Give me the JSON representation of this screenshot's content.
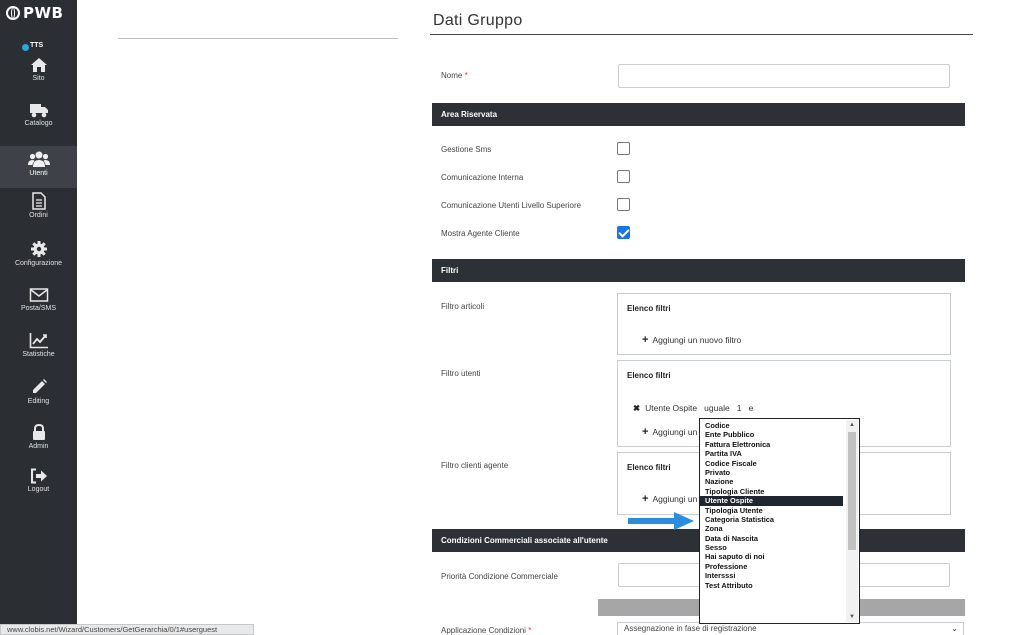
{
  "brand": {
    "name": "PWB",
    "env_label": "TTS"
  },
  "nav": [
    {
      "label": "Sito",
      "icon": "home-icon"
    },
    {
      "label": "Catalogo",
      "icon": "truck-icon"
    },
    {
      "label": "Utenti",
      "icon": "users-icon",
      "active": true
    },
    {
      "label": "Ordini",
      "icon": "document-icon"
    },
    {
      "label": "Configurazione",
      "icon": "gear-icon"
    },
    {
      "label": "Posta/SMS",
      "icon": "envelope-icon"
    },
    {
      "label": "Statistiche",
      "icon": "chart-icon"
    },
    {
      "label": "Editing",
      "icon": "pencil-icon"
    },
    {
      "label": "Admin",
      "icon": "lock-icon"
    },
    {
      "label": "Logout",
      "icon": "logout-icon"
    }
  ],
  "status_bar": {
    "url": "www.clobis.net/Wizard/Customers/GetGerarchia/0/1#userguest"
  },
  "form": {
    "title": "Dati Gruppo",
    "nome_label": "Nome",
    "nome_value": "",
    "required_mark": "*",
    "section_area_riservata": "Area Riservata",
    "checkboxes": [
      {
        "label": "Gestione Sms",
        "checked": false
      },
      {
        "label": "Comunicazione Interna",
        "checked": false
      },
      {
        "label": "Comunicazione Utenti Livello Superiore",
        "checked": false
      },
      {
        "label": "Mostra Agente Cliente",
        "checked": true
      }
    ],
    "section_filtri": "Filtri",
    "filters": [
      {
        "label": "Filtro articoli",
        "box_title": "Elenco filtri",
        "add_label": "Aggiungi un nuovo filtro"
      },
      {
        "label": "Filtro utenti",
        "box_title": "Elenco filtri",
        "row": "Utente Ospite   uguale   1   e",
        "add_label": "Aggiungi un"
      },
      {
        "label": "Filtro clienti agente",
        "box_title": "Elenco filtri",
        "add_label": "Aggiungi un"
      }
    ],
    "section_condizioni": "Condizioni Commerciali associate all'utente",
    "priorita_label": "Priorità Condizione Commerciale",
    "applicazione_label": "Applicazione Condizioni",
    "applicazione_value": "Assegnazione in fase di registrazione"
  },
  "dropdown": {
    "selected_index": 8,
    "options": [
      "Codice",
      "Ente Pubblico",
      "Fattura Elettronica",
      "Partita IVA",
      "Codice Fiscale",
      "Privato",
      "Nazione",
      "Tipologia Cliente",
      "Utente Ospite",
      "Tipologia Utente",
      "Categoria Statistica",
      "Zona",
      "Data di Nascita",
      "Sesso",
      "Hai saputo di noi",
      "Professione",
      "Intersssi",
      "Test Attributo"
    ]
  },
  "colors": {
    "sidebar": "#2b2e33",
    "section_bar": "#2d3035",
    "accent": "#1a73e8",
    "arrow": "#2b8de0"
  }
}
